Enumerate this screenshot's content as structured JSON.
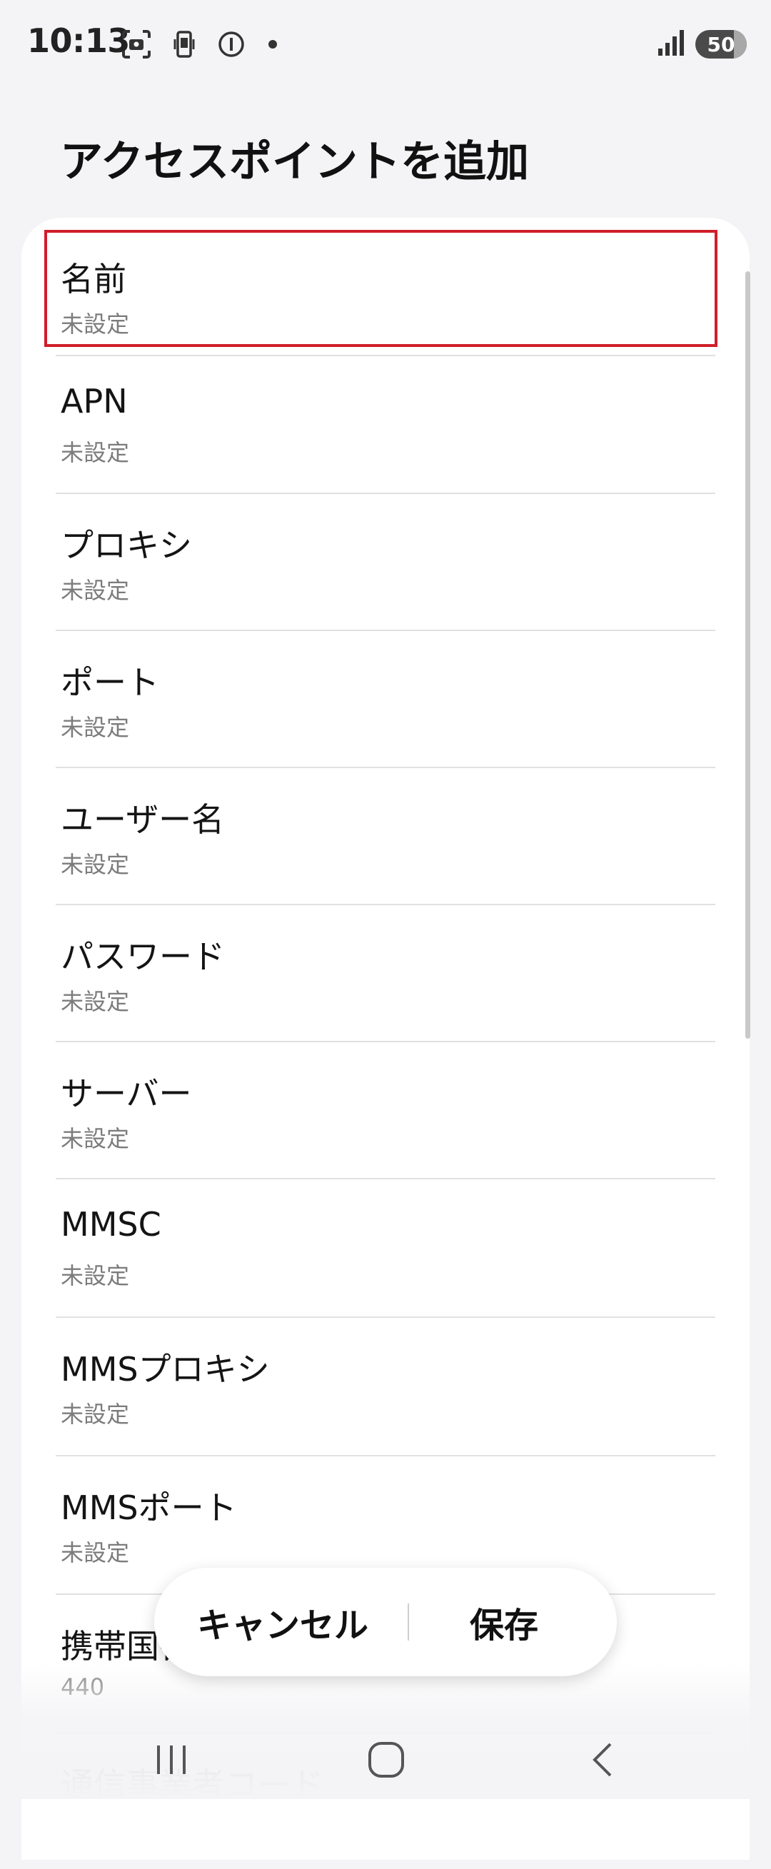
{
  "status": {
    "time": "10:13",
    "battery": "50",
    "icons": [
      "screenshot-icon",
      "phone-vibrate-icon",
      "info-circle-icon",
      "dot-icon",
      "signal-icon"
    ]
  },
  "page": {
    "title": "アクセスポイントを追加"
  },
  "items": [
    {
      "label": "名前",
      "value": "未設定"
    },
    {
      "label": "APN",
      "value": "未設定"
    },
    {
      "label": "プロキシ",
      "value": "未設定"
    },
    {
      "label": "ポート",
      "value": "未設定"
    },
    {
      "label": "ユーザー名",
      "value": "未設定"
    },
    {
      "label": "パスワード",
      "value": "未設定"
    },
    {
      "label": "サーバー",
      "value": "未設定"
    },
    {
      "label": "MMSC",
      "value": "未設定"
    },
    {
      "label": "MMSプロキシ",
      "value": "未設定"
    },
    {
      "label": "MMSポート",
      "value": "未設定"
    },
    {
      "label": "携帯国番号",
      "value": "440"
    },
    {
      "label": "通信事業者コード",
      "value": ""
    }
  ],
  "actions": {
    "cancel": "キャンセル",
    "save": "保存"
  },
  "colors": {
    "highlight": "#d01e2a",
    "background": "#f4f4f6"
  }
}
